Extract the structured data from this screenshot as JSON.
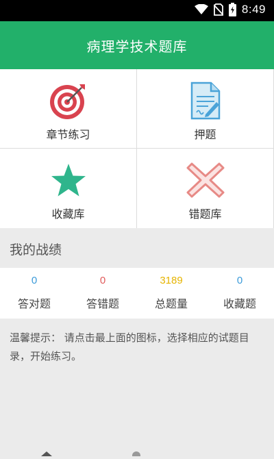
{
  "status_bar": {
    "time": "8:49"
  },
  "header": {
    "title": "病理学技术题库"
  },
  "menu": [
    {
      "label": "章节练习",
      "icon": "target-icon"
    },
    {
      "label": "押题",
      "icon": "document-edit-icon"
    },
    {
      "label": "收藏库",
      "icon": "star-icon"
    },
    {
      "label": "错题库",
      "icon": "cross-icon"
    }
  ],
  "record": {
    "title": "我的战绩",
    "stats": [
      {
        "value": "0",
        "label": "答对题",
        "color": "#3a9ad9"
      },
      {
        "value": "0",
        "label": "答错题",
        "color": "#e05a5a"
      },
      {
        "value": "3189",
        "label": "总题量",
        "color": "#e6b400"
      },
      {
        "value": "0",
        "label": "收藏题",
        "color": "#3a9ad9"
      }
    ]
  },
  "tip": "温馨提示： 请点击最上面的图标，选择相应的试题目录，开始练习。",
  "colors": {
    "brand": "#22b06a",
    "target": "#d9434f",
    "star": "#2fb58c",
    "cross": "#e78a86",
    "doc": "#4aa3d8"
  }
}
